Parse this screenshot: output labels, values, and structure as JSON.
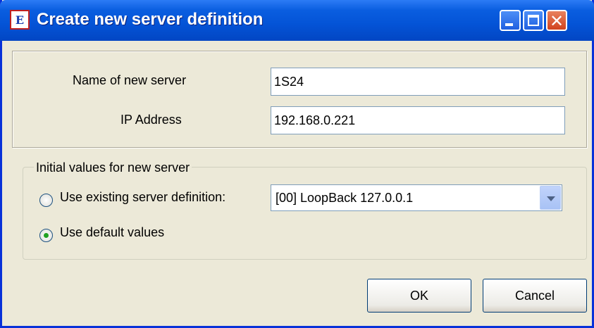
{
  "window": {
    "title": "Create new server definition",
    "app_icon_glyph": "E"
  },
  "server": {
    "name_label": "Name of new server",
    "name_value": "1S24",
    "ip_label": "IP Address",
    "ip_value": "192.168.0.221"
  },
  "initial": {
    "group_label": "Initial values for new server",
    "existing_label": "Use existing server definition:",
    "existing_selected": false,
    "dropdown_value": "[00] LoopBack 127.0.0.1",
    "default_label": "Use default values",
    "default_selected": true
  },
  "buttons": {
    "ok": "OK",
    "cancel": "Cancel"
  },
  "icons": {
    "close": "✕",
    "app": "app-icon"
  }
}
